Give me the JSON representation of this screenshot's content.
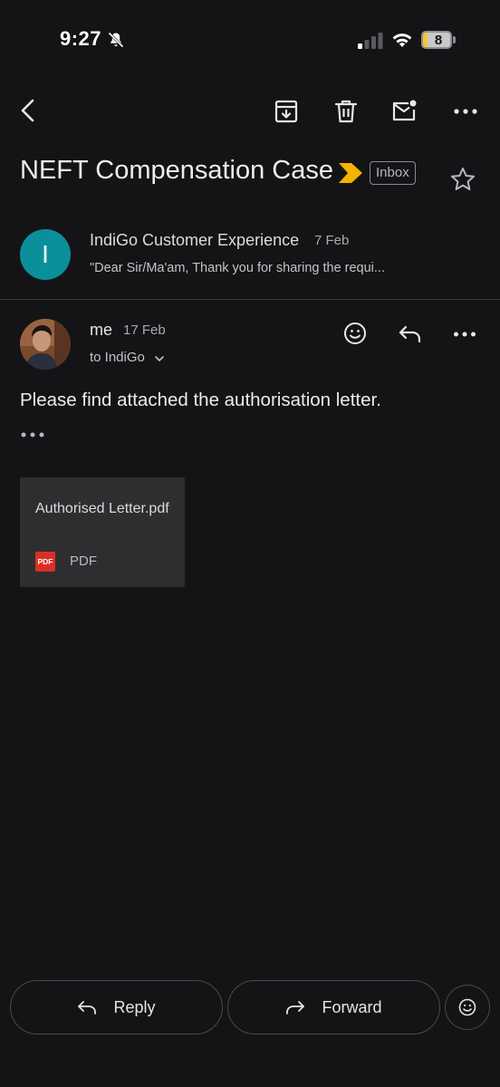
{
  "status_bar": {
    "time": "9:27",
    "battery_level": "8",
    "icons": [
      "bell-slash-icon",
      "signal-icon",
      "wifi-icon",
      "battery-icon"
    ]
  },
  "toolbar": {
    "icons": [
      "back-arrow-icon",
      "archive-icon",
      "trash-icon",
      "mark-unread-icon",
      "more-vert-icon"
    ]
  },
  "email": {
    "subject": "NEFT Compensation Case",
    "label": "Inbox",
    "importance_color": "#f5b400"
  },
  "messages": [
    {
      "avatar_letter": "I",
      "avatar_color": "#0b8f9a",
      "sender": "IndiGo Customer Experience",
      "date": "7 Feb",
      "snippet": "\"Dear Sir/Ma'am, Thank you for sharing the requi..."
    },
    {
      "sender": "me",
      "date": "17 Feb",
      "to": "to IndiGo",
      "body": "Please find attached the authorisation letter.",
      "attachment": {
        "name": "Authorised Letter.pdf",
        "type_badge": "PDF",
        "type_label": "PDF"
      }
    }
  ],
  "actions": {
    "reply": "Reply",
    "forward": "Forward"
  }
}
